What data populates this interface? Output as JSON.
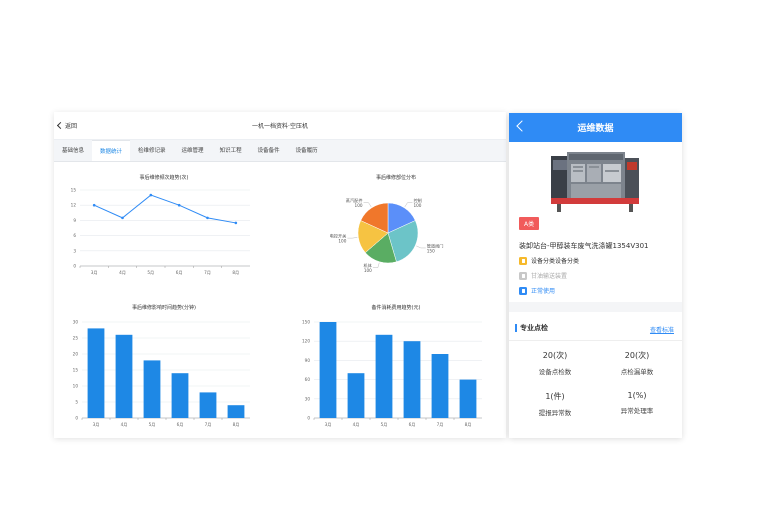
{
  "left_panel": {
    "back_label": "返回",
    "title": "一机一档资料·空压机",
    "tabs": [
      {
        "label": "基础信息",
        "active": false
      },
      {
        "label": "数据统计",
        "active": true
      },
      {
        "label": "检维修记录",
        "active": false
      },
      {
        "label": "运维管理",
        "active": false
      },
      {
        "label": "知识工程",
        "active": false
      },
      {
        "label": "设备备件",
        "active": false
      },
      {
        "label": "设备履历",
        "active": false
      }
    ]
  },
  "chart_data": [
    {
      "type": "line",
      "title": "事后维修频次趋势(次)",
      "categories": [
        "3月",
        "4月",
        "5月",
        "6月",
        "7月",
        "8月"
      ],
      "values": [
        12,
        9.5,
        14,
        12,
        9.5,
        8.5
      ],
      "ylim": [
        0,
        15
      ],
      "yticks": [
        0,
        3,
        6,
        9,
        12,
        15
      ],
      "color": "#2f8bf5",
      "grid": true
    },
    {
      "type": "pie",
      "title": "事后维修部位分布",
      "slices": [
        {
          "label": "控制",
          "value": 100,
          "color": "#5b8ff9"
        },
        {
          "label": "管道阀门",
          "value": 150,
          "color": "#6cc4c8"
        },
        {
          "label": "机体",
          "value": 100,
          "color": "#5aad63"
        },
        {
          "label": "电控开关",
          "value": 100,
          "color": "#f6c342"
        },
        {
          "label": "蒸汽配件",
          "value": 100,
          "color": "#f0772b"
        }
      ],
      "slice_value_labels": [
        "100",
        "150",
        "100",
        "100",
        "100"
      ]
    },
    {
      "type": "bar",
      "title": "事后维修影响时间趋势(分钟)",
      "categories": [
        "3月",
        "4月",
        "5月",
        "6月",
        "7月",
        "8月"
      ],
      "values": [
        28,
        26,
        18,
        14,
        8,
        4
      ],
      "ylim": [
        0,
        30
      ],
      "yticks": [
        0,
        5,
        10,
        15,
        20,
        25,
        30
      ],
      "color": "#1e88e5",
      "grid": true
    },
    {
      "type": "bar",
      "title": "备件消耗费用趋势(元)",
      "categories": [
        "3月",
        "4月",
        "5月",
        "6月",
        "7月",
        "8月"
      ],
      "values": [
        150,
        70,
        130,
        120,
        100,
        60
      ],
      "ylim": [
        0,
        150
      ],
      "yticks": [
        0,
        30,
        60,
        90,
        120,
        150
      ],
      "color": "#1e88e5",
      "grid": true
    }
  ],
  "right_panel": {
    "header_title": "运维数据",
    "badge": "A类",
    "equipment_name": "装卸站台-甲醇装车废气洗涤罐1354V301",
    "info_rows": [
      {
        "icon": "category-icon",
        "text": "设备分类设备分类",
        "color": "#333333"
      },
      {
        "icon": "document-icon",
        "text": "甘油输送装置",
        "color": "#aaaaaa"
      },
      {
        "icon": "status-icon",
        "text": "正常使用",
        "color": "#2f8bf5"
      }
    ],
    "section": {
      "title": "专业点检",
      "link": "查看标准",
      "stats": [
        {
          "value": "20(次)",
          "label": "设备点检数"
        },
        {
          "value": "20(次)",
          "label": "点检漏单数"
        },
        {
          "value": "1(件)",
          "label": "提报异常数"
        },
        {
          "value": "1(%)",
          "label": "异常处理率"
        }
      ]
    }
  },
  "colors": {
    "accent": "#2f8bf5",
    "badge": "#f15b5b"
  }
}
